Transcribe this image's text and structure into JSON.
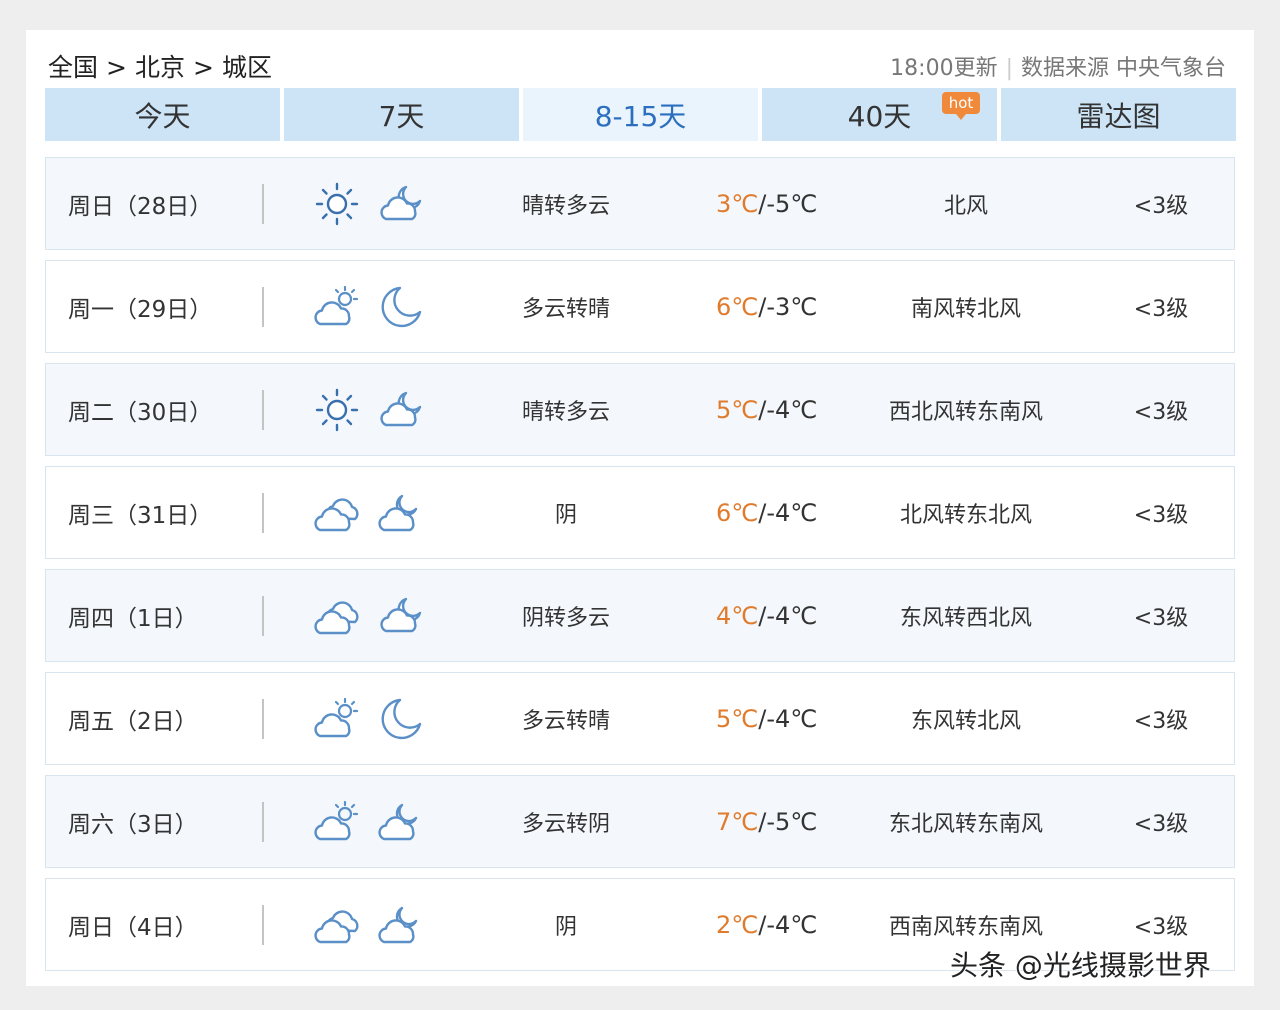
{
  "breadcrumb": {
    "country": "全国",
    "city": "北京",
    "district": "城区",
    "separator": ">"
  },
  "meta": {
    "update": "18:00更新",
    "source": "数据来源 中央气象台"
  },
  "tabs": [
    {
      "label": "今天",
      "active": false
    },
    {
      "label": "7天",
      "active": false
    },
    {
      "label": "8-15天",
      "active": true
    },
    {
      "label": "40天",
      "active": false,
      "badge": "hot"
    },
    {
      "label": "雷达图",
      "active": false
    }
  ],
  "colors": {
    "high_temp": "#e07b2c",
    "tab_bg": "#cde4f6",
    "tab_active_text": "#2c6fbf",
    "icon_stroke": "#5a8fc7",
    "sun_stroke": "#3a6fae"
  },
  "days": [
    {
      "day": "周日（28日）",
      "icon_day": "sun-icon",
      "icon_night": "cloud-moon-icon",
      "desc": "晴转多云",
      "high": "3℃",
      "low": "/-5℃",
      "wind": "北风",
      "level": "<3级"
    },
    {
      "day": "周一（29日）",
      "icon_day": "sun-cloud-icon",
      "icon_night": "moon-icon",
      "desc": "多云转晴",
      "high": "6℃",
      "low": "/-3℃",
      "wind": "南风转北风",
      "level": "<3级"
    },
    {
      "day": "周二（30日）",
      "icon_day": "sun-icon",
      "icon_night": "cloud-moon-icon",
      "desc": "晴转多云",
      "high": "5℃",
      "low": "/-4℃",
      "wind": "西北风转东南风",
      "level": "<3级"
    },
    {
      "day": "周三（31日）",
      "icon_day": "overcast-icon",
      "icon_night": "moon-cloud-icon",
      "desc": "阴",
      "high": "6℃",
      "low": "/-4℃",
      "wind": "北风转东北风",
      "level": "<3级"
    },
    {
      "day": "周四（1日）",
      "icon_day": "overcast-icon",
      "icon_night": "cloud-moon-icon",
      "desc": "阴转多云",
      "high": "4℃",
      "low": "/-4℃",
      "wind": "东风转西北风",
      "level": "<3级"
    },
    {
      "day": "周五（2日）",
      "icon_day": "sun-cloud-icon",
      "icon_night": "moon-icon",
      "desc": "多云转晴",
      "high": "5℃",
      "low": "/-4℃",
      "wind": "东风转北风",
      "level": "<3级"
    },
    {
      "day": "周六（3日）",
      "icon_day": "sun-cloud-icon",
      "icon_night": "moon-cloud-icon",
      "desc": "多云转阴",
      "high": "7℃",
      "low": "/-5℃",
      "wind": "东北风转东南风",
      "level": "<3级"
    },
    {
      "day": "周日（4日）",
      "icon_day": "overcast-icon",
      "icon_night": "moon-cloud-icon",
      "desc": "阴",
      "high": "2℃",
      "low": "/-4℃",
      "wind": "西南风转东南风",
      "level": "<3级"
    }
  ],
  "watermark": "头条 @光线摄影世界"
}
